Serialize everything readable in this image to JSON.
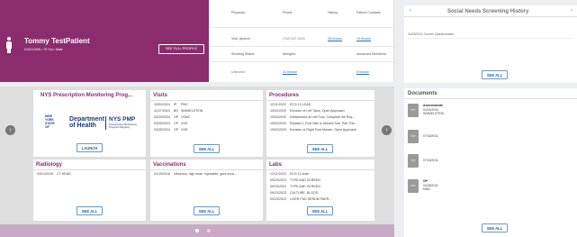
{
  "patient": {
    "name": "Tommy TestPatient",
    "meta": "01/01/1945 • 79 Yrs • Male",
    "see_profile": "SEE FULL PROFILE"
  },
  "info": {
    "physician_label": "Physician:",
    "phone_label": "Phone:",
    "history_label": "History:",
    "contacts_label": "Patient Contacts:",
    "visit_label": "Visit: (Active)",
    "visit_value": "",
    "phone_value": "(732) 947-3216",
    "history_value": "28 Known",
    "contacts_value": "10 Known",
    "smoking_label": "Smoking Status:",
    "allergies_label": "Allergies:",
    "directives_label": "Advanced Directives:",
    "smoking_value": "Unknown",
    "allergies_value": "21 Known",
    "directives_value": "5 Known"
  },
  "social_needs": {
    "title": "Social Needs Screening History",
    "prev": "‹",
    "next": "›",
    "row": "04/18/2024   Current Questionnaire",
    "see_all": "SEE ALL"
  },
  "dashboard": {
    "prev": "‹",
    "next": "›",
    "pmp": {
      "title": "NYS Prescription Monitoring Prog...",
      "ny_lines": [
        "NEW",
        "YORK",
        "STATE",
        "OF"
      ],
      "dept": "Department",
      "dept2": "of Health",
      "right": "NYS PMP",
      "sub1": "Prescription Monitoring",
      "sub2": "Program Registry",
      "launch": "LAUNCH"
    },
    "visits": {
      "title": "Visits",
      "rows": [
        {
          "date": "10/02/2024",
          "code": "IP",
          "desc": "PMC"
        },
        {
          "date": "11/27/2023",
          "code": "BO",
          "desc": "SIMMELSTEIN"
        },
        {
          "date": "03/29/2024",
          "code": "OP",
          "desc": "VSMC"
        },
        {
          "date": "03/25/2024",
          "code": "OP",
          "desc": "VOE"
        },
        {
          "date": "03/25/2024",
          "code": "OP",
          "desc": "VOE"
        }
      ],
      "see_all": "SEE ALL"
    },
    "procedures": {
      "title": "Procedures",
      "rows": [
        {
          "date": "12/11/2022",
          "desc": "ECG 12-LEAD"
        },
        {
          "date": "10/02/2020",
          "desc": "Excision of Left Talus, Open Approach"
        },
        {
          "date": "10/02/2020",
          "desc": "Detachment at Left Foot, Complete 4th Ray..."
        },
        {
          "date": "10/02/2020",
          "desc": "Replace L Foot Skin w Nonaut Sub, Part Thic..."
        },
        {
          "date": "10/02/2020",
          "desc": "Excision of Right Foot Muscle, Open Approach"
        }
      ],
      "see_all": "SEE ALL"
    },
    "radiology": {
      "title": "Radiology",
      "rows": [
        {
          "date": "04/21/2016",
          "desc": "CT HEAD"
        }
      ],
      "see_all": "SEE ALL"
    },
    "vaccinations": {
      "title": "Vaccinations",
      "rows": [
        {
          "date": "01/19/2016",
          "desc": "Influenza, high dose, injectable, gent-virus..."
        }
      ],
      "see_all": "SEE ALL"
    },
    "labs": {
      "title": "Labs",
      "rows": [
        {
          "date": "12/11/2023",
          "desc": "ECG 12-lead"
        },
        {
          "date": "09/23/2023",
          "desc": "TYPE AND SCREEN"
        },
        {
          "date": "09/23/2023",
          "desc": "TYPE AND SCREEN"
        },
        {
          "date": "09/23/2023",
          "desc": "CULTURE, BLOOD"
        },
        {
          "date": "09/23/2023",
          "desc": "LIVER FUD SERUM PAER..."
        }
      ],
      "see_all": "SEE ALL"
    }
  },
  "documents": {
    "title": "Documents",
    "items": [
      {
        "icon": "TXT",
        "lines": [
          "Assessments",
          "04/24/2024",
          "SIMMELSTEIN"
        ],
        "bold_first": true
      },
      {
        "icon": "TXT",
        "lines": [
          "07/18/2011"
        ],
        "bold_first": false
      },
      {
        "icon": "TXT",
        "lines": [
          "07/18/2011"
        ],
        "bold_first": false
      },
      {
        "icon": "TXT",
        "lines": [
          "OP",
          "03/28/2011",
          "MMC"
        ],
        "bold_first": true
      }
    ],
    "see_all": "SEE ALL"
  }
}
